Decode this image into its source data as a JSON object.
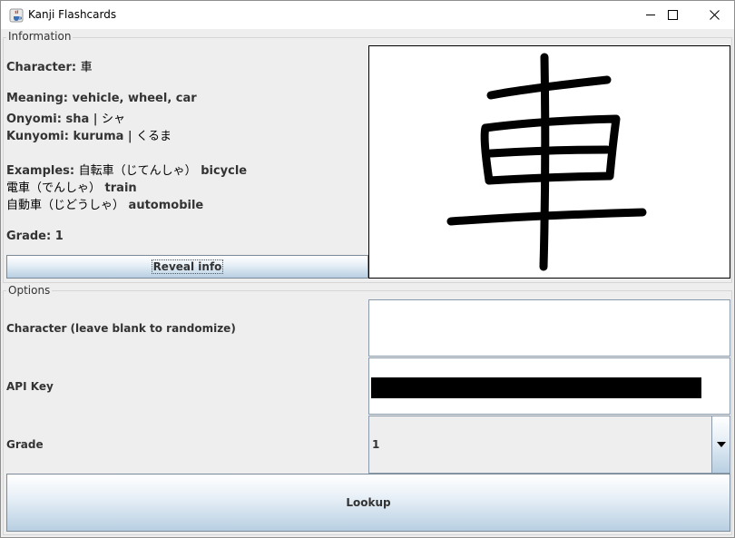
{
  "window": {
    "title": "Kanji Flashcards",
    "minimize_glyph": "—",
    "maximize_glyph": "☐",
    "close_glyph": "✕"
  },
  "information": {
    "legend": "Information",
    "character_label": "Character:",
    "character_value": "車",
    "meaning_label": "Meaning:",
    "meaning_value": "vehicle, wheel, car",
    "onyomi_label": "Onyomi:",
    "onyomi_romaji": "sha |",
    "onyomi_kana": "シャ",
    "kunyomi_label": "Kunyomi:",
    "kunyomi_romaji": "kuruma |",
    "kunyomi_kana": "くるま",
    "examples_label": "Examples:",
    "examples": [
      {
        "word": "自転車（じてんしゃ）",
        "meaning": "bicycle"
      },
      {
        "word": "電車（でんしゃ）",
        "meaning": "train"
      },
      {
        "word": "自動車（じどうしゃ）",
        "meaning": "automobile"
      }
    ],
    "grade_label": "Grade:",
    "grade_value": "1",
    "kanji_image_char": "車",
    "reveal_button": "Reveal info"
  },
  "options": {
    "legend": "Options",
    "character_label": "Character (leave blank to randomize)",
    "character_value": "",
    "api_key_label": "API Key",
    "grade_label": "Grade",
    "grade_selected": "1",
    "lookup_button": "Lookup"
  },
  "colors": {
    "button_gradient_top": "#ffffff",
    "button_gradient_bottom": "#b8cfe2",
    "panel_bg": "#eeeeee"
  },
  "icons": {
    "app": "java-cup-icon",
    "dropdown": "chevron-down-icon"
  }
}
